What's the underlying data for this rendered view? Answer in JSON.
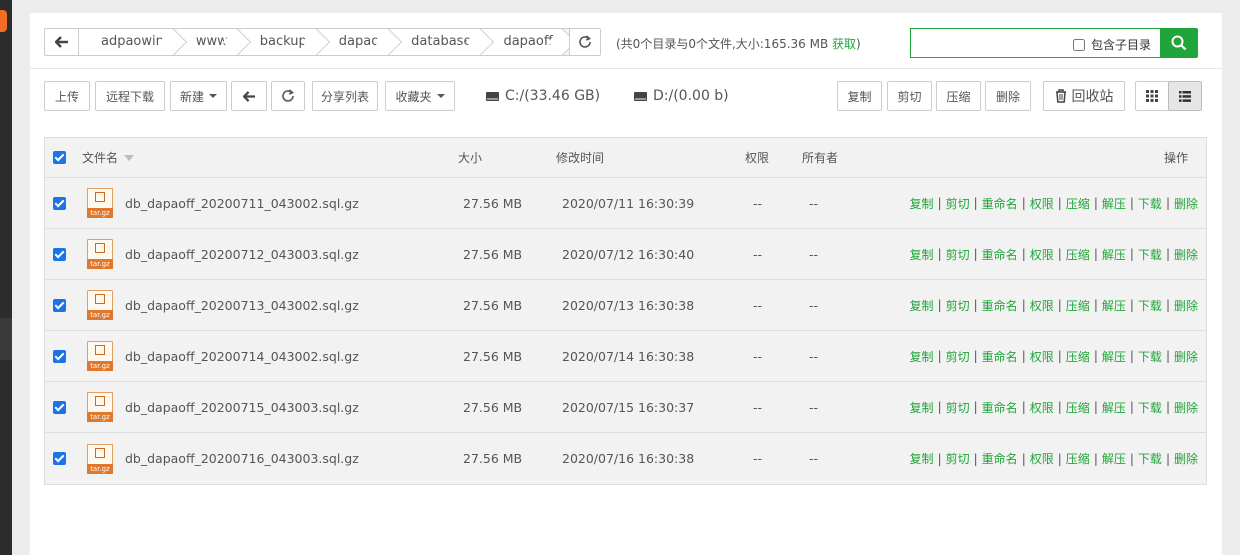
{
  "path": {
    "crumbs": [
      "adpaowin",
      "www",
      "backup",
      "dapao",
      "database",
      "dapaoff"
    ],
    "summary": "(共0个目录与0个文件,大小:165.36 MB",
    "summary_link": "获取",
    "summary_end": ")",
    "search_placeholder": "",
    "include_subdir_label": "包含子目录"
  },
  "toolbar": {
    "upload": "上传",
    "remote_download": "远程下载",
    "new": "新建",
    "share_list": "分享列表",
    "favorites": "收藏夹",
    "disk_c": "C:/(33.46 GB)",
    "disk_d": "D:/(0.00 b)",
    "copy": "复制",
    "cut": "剪切",
    "compress": "压缩",
    "delete": "删除",
    "recycle_bin": "回收站"
  },
  "table": {
    "headers": {
      "name": "文件名",
      "size": "大小",
      "mtime": "修改时间",
      "perm": "权限",
      "owner": "所有者",
      "actions": "操作"
    },
    "icon_tag": "tar.gz",
    "actions": [
      "复制",
      "剪切",
      "重命名",
      "权限",
      "压缩",
      "解压",
      "下载",
      "删除"
    ],
    "rows": [
      {
        "name": "db_dapaoff_20200711_043002.sql.gz",
        "size": "27.56 MB",
        "mtime": "2020/07/11 16:30:39",
        "perm": "--",
        "owner": "--"
      },
      {
        "name": "db_dapaoff_20200712_043003.sql.gz",
        "size": "27.56 MB",
        "mtime": "2020/07/12 16:30:40",
        "perm": "--",
        "owner": "--"
      },
      {
        "name": "db_dapaoff_20200713_043002.sql.gz",
        "size": "27.56 MB",
        "mtime": "2020/07/13 16:30:38",
        "perm": "--",
        "owner": "--"
      },
      {
        "name": "db_dapaoff_20200714_043002.sql.gz",
        "size": "27.56 MB",
        "mtime": "2020/07/14 16:30:38",
        "perm": "--",
        "owner": "--"
      },
      {
        "name": "db_dapaoff_20200715_043003.sql.gz",
        "size": "27.56 MB",
        "mtime": "2020/07/15 16:30:37",
        "perm": "--",
        "owner": "--"
      },
      {
        "name": "db_dapaoff_20200716_043003.sql.gz",
        "size": "27.56 MB",
        "mtime": "2020/07/16 16:30:38",
        "perm": "--",
        "owner": "--"
      }
    ]
  },
  "colors": {
    "accent_green": "#20a53a",
    "checkbox_blue": "#1a73e8",
    "archive_orange": "#e0772a"
  }
}
